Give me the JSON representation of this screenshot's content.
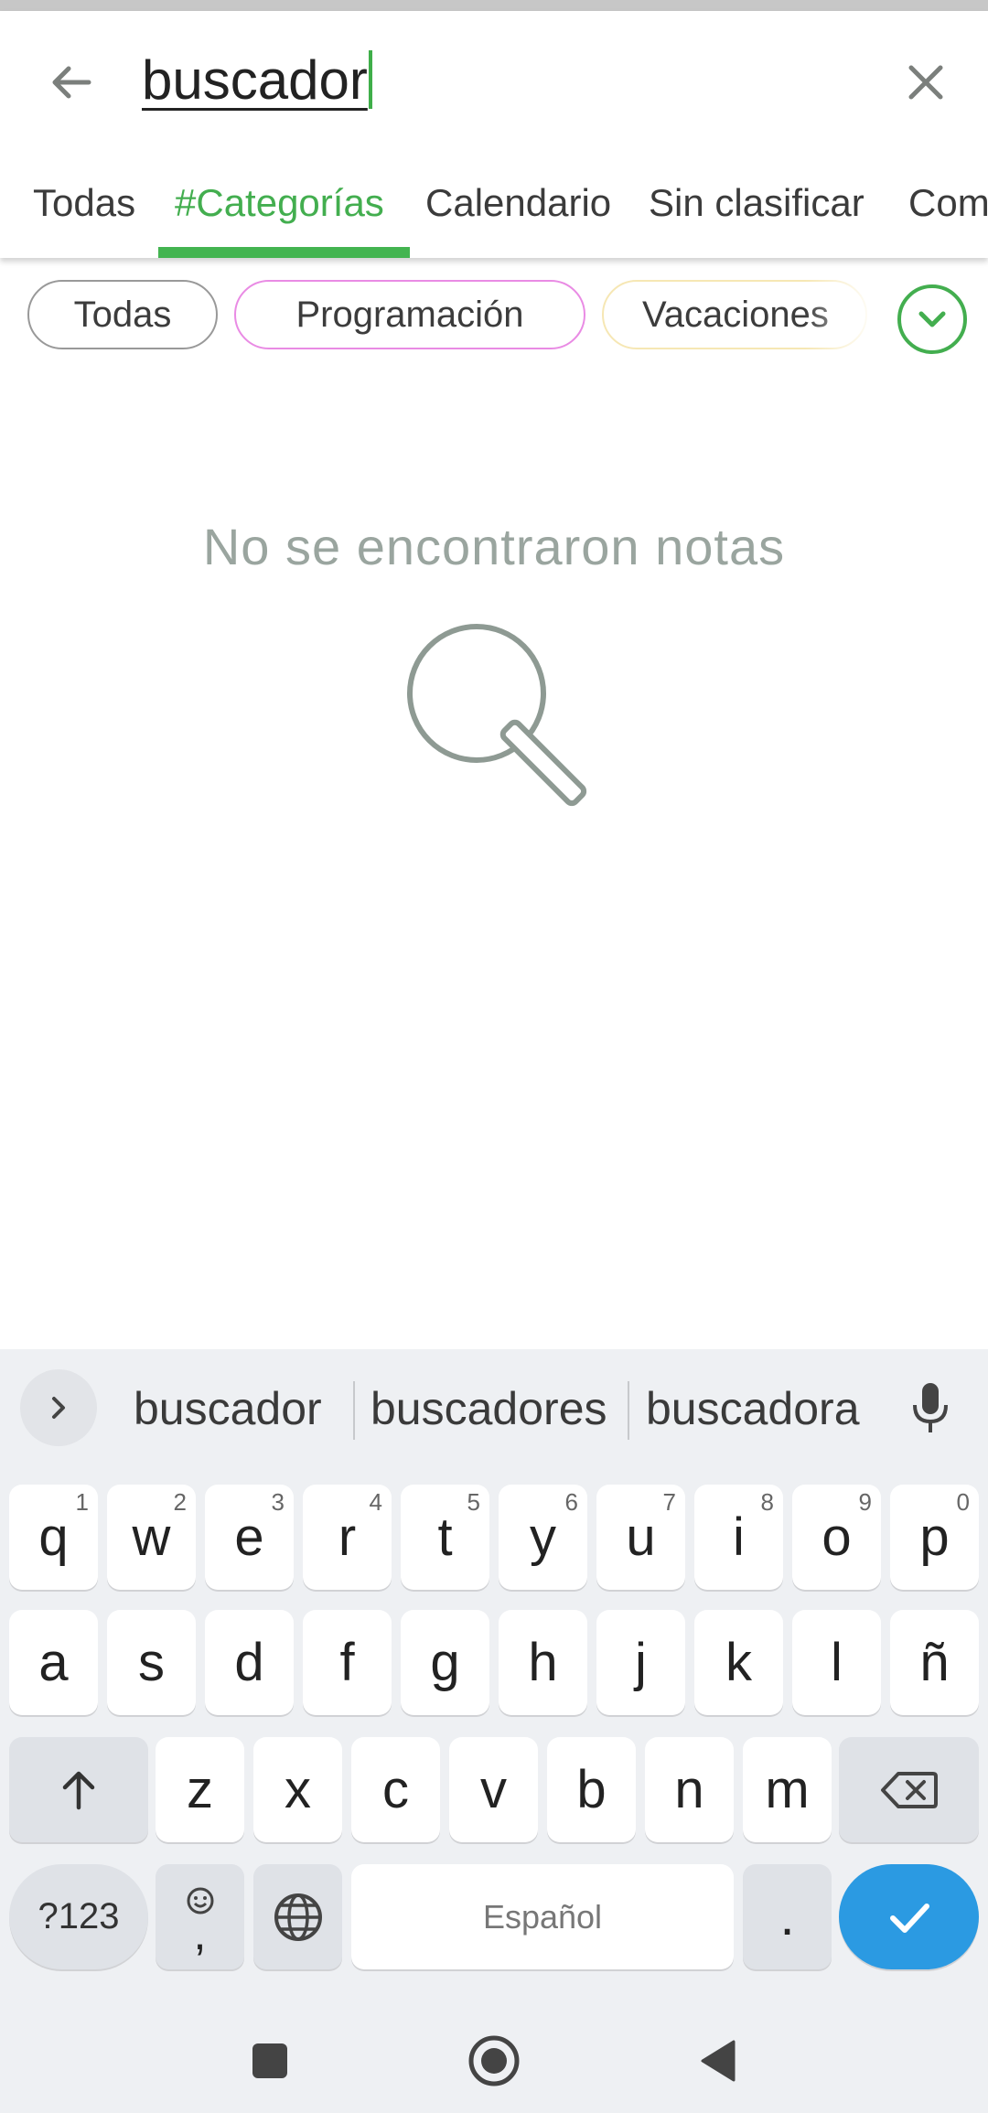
{
  "search": {
    "query": "buscador"
  },
  "tabs": [
    {
      "label": "Todas",
      "active": false
    },
    {
      "label": "#Categorías",
      "active": true
    },
    {
      "label": "Calendario",
      "active": false
    },
    {
      "label": "Sin clasificar",
      "active": false
    },
    {
      "label": "Com",
      "active": false
    }
  ],
  "chips": [
    {
      "label": "Todas",
      "color": "#999999"
    },
    {
      "label": "Programación",
      "color": "#e98be4"
    },
    {
      "label": "Vacaciones",
      "color": "#f6e7b4"
    }
  ],
  "empty_state": {
    "message": "No se encontraron notas",
    "icon": "magnifier-icon"
  },
  "keyboard": {
    "suggestions": [
      "buscador",
      "buscadores",
      "buscadora"
    ],
    "row1": [
      {
        "k": "q",
        "h": "1"
      },
      {
        "k": "w",
        "h": "2"
      },
      {
        "k": "e",
        "h": "3"
      },
      {
        "k": "r",
        "h": "4"
      },
      {
        "k": "t",
        "h": "5"
      },
      {
        "k": "y",
        "h": "6"
      },
      {
        "k": "u",
        "h": "7"
      },
      {
        "k": "i",
        "h": "8"
      },
      {
        "k": "o",
        "h": "9"
      },
      {
        "k": "p",
        "h": "0"
      }
    ],
    "row2": [
      "a",
      "s",
      "d",
      "f",
      "g",
      "h",
      "j",
      "k",
      "l",
      "ñ"
    ],
    "row3": [
      "z",
      "x",
      "c",
      "v",
      "b",
      "n",
      "m"
    ],
    "symbols_label": "?123",
    "comma_label": ",",
    "space_label": "Español",
    "period_label": "."
  },
  "colors": {
    "accent": "#43ae4f",
    "enter": "#2b9ae2",
    "empty_text": "#9aa59f"
  }
}
